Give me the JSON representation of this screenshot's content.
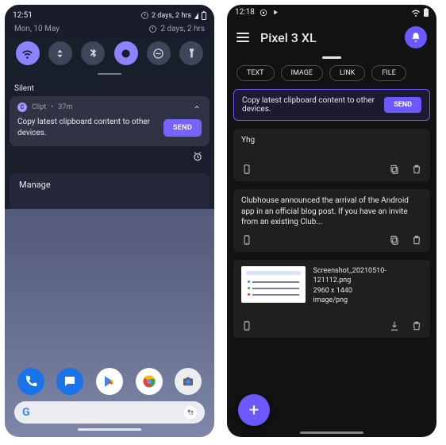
{
  "left": {
    "statusbar": {
      "time": "12:51",
      "battery_text": "2 days, 2 hrs"
    },
    "date": "Mon, 10 May",
    "qs": [
      {
        "name": "wifi",
        "on": true
      },
      {
        "name": "data",
        "on": false
      },
      {
        "name": "bluetooth",
        "on": false
      },
      {
        "name": "dark-mode",
        "on": true
      },
      {
        "name": "dnd",
        "on": false
      },
      {
        "name": "flashlight",
        "on": false
      }
    ],
    "silent_header": "Silent",
    "notification": {
      "app": "Clipt",
      "age": "37m",
      "text": "Copy latest clipboard content to other devices.",
      "action": "SEND"
    },
    "manage": "Manage",
    "dock": [
      "phone",
      "messages",
      "play-store",
      "chrome",
      "camera"
    ]
  },
  "right": {
    "statusbar": {
      "time": "12:18"
    },
    "title": "Pixel 3 XL",
    "chips": [
      "TEXT",
      "IMAGE",
      "LINK",
      "FILE"
    ],
    "action": {
      "text": "Copy latest clipboard content to other devices.",
      "button": "SEND"
    },
    "items": [
      {
        "type": "text",
        "body": "Yhg"
      },
      {
        "type": "text",
        "body": "Clubhouse announced the arrival of the Android app in an official blog post. If you have an invite from an existing Club..."
      },
      {
        "type": "image",
        "filename": "Screenshot_20210510-121112.png",
        "dims": "2960 x 1440",
        "mime": "image/png"
      }
    ],
    "fab": "+"
  }
}
